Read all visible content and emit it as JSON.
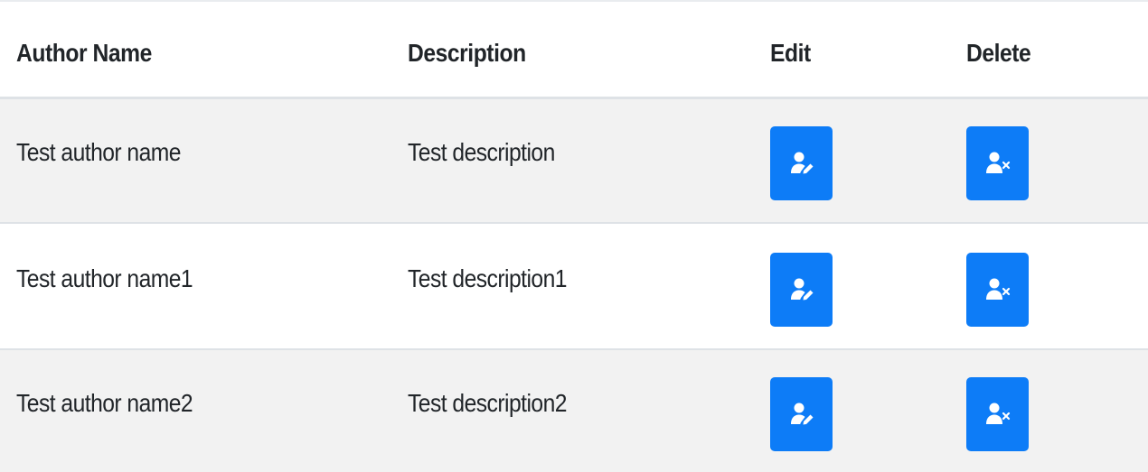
{
  "table": {
    "headers": {
      "author": "Author Name",
      "description": "Description",
      "edit": "Edit",
      "delete": "Delete"
    },
    "rows": [
      {
        "author": "Test author name",
        "description": "Test description"
      },
      {
        "author": "Test author name1",
        "description": "Test description1"
      },
      {
        "author": "Test author name2",
        "description": "Test description2"
      }
    ],
    "edit_icon": "user-edit-icon",
    "delete_icon": "user-remove-icon"
  },
  "colors": {
    "button": "#0d7cf7",
    "stripe": "#f2f2f2",
    "divider": "#dee2e6"
  }
}
